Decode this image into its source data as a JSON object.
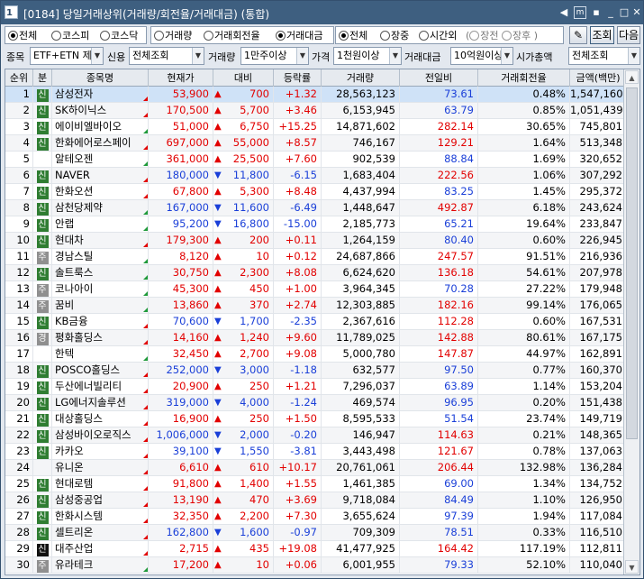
{
  "window": {
    "number": "1",
    "title": "[0184] 당일거래상위(거래량/회전율/거래대금) (통합)",
    "btn_left": "◀",
    "btn_box": "m",
    "btn_pin": "▪",
    "btn_min": "_",
    "btn_max": "□",
    "btn_close": "✕"
  },
  "market_filter": {
    "options": [
      "전체",
      "코스피",
      "코스닥"
    ],
    "selected": 0
  },
  "sort_filter": {
    "options": [
      "거래량",
      "거래회전율",
      "거래대금"
    ],
    "selected": 2
  },
  "session_filter": {
    "options": [
      "전체",
      "장중",
      "시간외"
    ],
    "selected": 0,
    "sub_options": [
      "장전",
      "장후"
    ]
  },
  "buttons": {
    "settings": "✎",
    "search": "조회",
    "next": "다음"
  },
  "filters": {
    "item_label": "종목",
    "item_value": "ETF+ETN 제",
    "credit_label": "신용",
    "credit_value": "전체조회",
    "volume_label": "거래량",
    "volume_value": "1만주이상",
    "price_label": "가격",
    "price_value": "1천원이상",
    "amount_label": "거래대금",
    "amount_value": "10억원이상",
    "mcap_label": "시가총액",
    "mcap_value": "전체조회"
  },
  "columns": [
    "순위",
    "분",
    "종목명",
    "현재가",
    "대비",
    "등락률",
    "거래량",
    "전일비",
    "거래회전율",
    "금액(백만)"
  ],
  "colors": {
    "badge_green": "#2f7d32",
    "badge_gray": "#8f8f8f",
    "badge_black": "#111111",
    "up": "#e20000",
    "down": "#1a3fd8"
  },
  "rows": [
    {
      "rank": "1",
      "tag": "신",
      "tag_color": "green",
      "name": "삼성전자",
      "price": "53,900",
      "arrow": "▲",
      "diff": "700",
      "rate": "+1.32",
      "volume": "28,563,123",
      "prev": "73.61",
      "turnover": "0.48%",
      "amount": "1,547,160",
      "dir": "up",
      "prev_dir": "dn",
      "mark": "red"
    },
    {
      "rank": "2",
      "tag": "신",
      "tag_color": "green",
      "name": "SK하이닉스",
      "price": "170,500",
      "arrow": "▲",
      "diff": "5,700",
      "rate": "+3.46",
      "volume": "6,153,945",
      "prev": "63.79",
      "turnover": "0.85%",
      "amount": "1,051,439",
      "dir": "up",
      "prev_dir": "dn",
      "mark": "red"
    },
    {
      "rank": "3",
      "tag": "신",
      "tag_color": "green",
      "name": "에이비엘바이오",
      "price": "51,000",
      "arrow": "▲",
      "diff": "6,750",
      "rate": "+15.25",
      "volume": "14,871,602",
      "prev": "282.14",
      "turnover": "30.65%",
      "amount": "745,801",
      "dir": "up",
      "prev_dir": "up",
      "mark": "green"
    },
    {
      "rank": "4",
      "tag": "신",
      "tag_color": "green",
      "name": "한화에어로스페이",
      "price": "697,000",
      "arrow": "▲",
      "diff": "55,000",
      "rate": "+8.57",
      "volume": "746,167",
      "prev": "129.21",
      "turnover": "1.64%",
      "amount": "513,348",
      "dir": "up",
      "prev_dir": "up",
      "mark": "red"
    },
    {
      "rank": "5",
      "tag": "",
      "tag_color": "",
      "name": "알테오젠",
      "price": "361,000",
      "arrow": "▲",
      "diff": "25,500",
      "rate": "+7.60",
      "volume": "902,539",
      "prev": "88.84",
      "turnover": "1.69%",
      "amount": "320,652",
      "dir": "up",
      "prev_dir": "dn",
      "mark": "green"
    },
    {
      "rank": "6",
      "tag": "신",
      "tag_color": "green",
      "name": "NAVER",
      "price": "180,000",
      "arrow": "▼",
      "diff": "11,800",
      "rate": "-6.15",
      "volume": "1,683,404",
      "prev": "222.56",
      "turnover": "1.06%",
      "amount": "307,292",
      "dir": "dn",
      "prev_dir": "up",
      "mark": "red"
    },
    {
      "rank": "7",
      "tag": "신",
      "tag_color": "green",
      "name": "한화오션",
      "price": "67,800",
      "arrow": "▲",
      "diff": "5,300",
      "rate": "+8.48",
      "volume": "4,437,994",
      "prev": "83.25",
      "turnover": "1.45%",
      "amount": "295,372",
      "dir": "up",
      "prev_dir": "dn",
      "mark": "red"
    },
    {
      "rank": "8",
      "tag": "신",
      "tag_color": "green",
      "name": "삼천당제약",
      "price": "167,000",
      "arrow": "▼",
      "diff": "11,600",
      "rate": "-6.49",
      "volume": "1,448,647",
      "prev": "492.87",
      "turnover": "6.18%",
      "amount": "243,624",
      "dir": "dn",
      "prev_dir": "up",
      "mark": "green"
    },
    {
      "rank": "9",
      "tag": "신",
      "tag_color": "green",
      "name": "안랩",
      "price": "95,200",
      "arrow": "▼",
      "diff": "16,800",
      "rate": "-15.00",
      "volume": "2,185,773",
      "prev": "65.21",
      "turnover": "19.64%",
      "amount": "233,847",
      "dir": "dn",
      "prev_dir": "dn",
      "mark": "green"
    },
    {
      "rank": "10",
      "tag": "신",
      "tag_color": "green",
      "name": "현대차",
      "price": "179,300",
      "arrow": "▲",
      "diff": "200",
      "rate": "+0.11",
      "volume": "1,264,159",
      "prev": "80.40",
      "turnover": "0.60%",
      "amount": "226,945",
      "dir": "up",
      "prev_dir": "dn",
      "mark": "red"
    },
    {
      "rank": "11",
      "tag": "주",
      "tag_color": "gray",
      "name": "경남스틸",
      "price": "8,120",
      "arrow": "▲",
      "diff": "10",
      "rate": "+0.12",
      "volume": "24,687,866",
      "prev": "247.57",
      "turnover": "91.51%",
      "amount": "216,936",
      "dir": "up",
      "prev_dir": "up",
      "mark": "green"
    },
    {
      "rank": "12",
      "tag": "신",
      "tag_color": "green",
      "name": "솔트룩스",
      "price": "30,750",
      "arrow": "▲",
      "diff": "2,300",
      "rate": "+8.08",
      "volume": "6,624,620",
      "prev": "136.18",
      "turnover": "54.61%",
      "amount": "207,978",
      "dir": "up",
      "prev_dir": "up",
      "mark": "green"
    },
    {
      "rank": "13",
      "tag": "주",
      "tag_color": "gray",
      "name": "코나아이",
      "price": "45,300",
      "arrow": "▲",
      "diff": "450",
      "rate": "+1.00",
      "volume": "3,964,345",
      "prev": "70.28",
      "turnover": "27.22%",
      "amount": "179,948",
      "dir": "up",
      "prev_dir": "dn",
      "mark": "green"
    },
    {
      "rank": "14",
      "tag": "주",
      "tag_color": "gray",
      "name": "꿈비",
      "price": "13,860",
      "arrow": "▲",
      "diff": "370",
      "rate": "+2.74",
      "volume": "12,303,885",
      "prev": "182.16",
      "turnover": "99.14%",
      "amount": "176,065",
      "dir": "up",
      "prev_dir": "up",
      "mark": "green"
    },
    {
      "rank": "15",
      "tag": "신",
      "tag_color": "green",
      "name": "KB금융",
      "price": "70,600",
      "arrow": "▼",
      "diff": "1,700",
      "rate": "-2.35",
      "volume": "2,367,616",
      "prev": "112.28",
      "turnover": "0.60%",
      "amount": "167,531",
      "dir": "dn",
      "prev_dir": "up",
      "mark": "red"
    },
    {
      "rank": "16",
      "tag": "경",
      "tag_color": "gray",
      "name": "평화홀딩스",
      "price": "14,160",
      "arrow": "▲",
      "diff": "1,240",
      "rate": "+9.60",
      "volume": "11,789,025",
      "prev": "142.88",
      "turnover": "80.61%",
      "amount": "167,175",
      "dir": "up",
      "prev_dir": "up",
      "mark": "red"
    },
    {
      "rank": "17",
      "tag": "",
      "tag_color": "",
      "name": "한텍",
      "price": "32,450",
      "arrow": "▲",
      "diff": "2,700",
      "rate": "+9.08",
      "volume": "5,000,780",
      "prev": "147.87",
      "turnover": "44.97%",
      "amount": "162,891",
      "dir": "up",
      "prev_dir": "up",
      "mark": "green"
    },
    {
      "rank": "18",
      "tag": "신",
      "tag_color": "green",
      "name": "POSCO홀딩스",
      "price": "252,000",
      "arrow": "▼",
      "diff": "3,000",
      "rate": "-1.18",
      "volume": "632,577",
      "prev": "97.50",
      "turnover": "0.77%",
      "amount": "160,370",
      "dir": "dn",
      "prev_dir": "dn",
      "mark": "red"
    },
    {
      "rank": "19",
      "tag": "신",
      "tag_color": "green",
      "name": "두산에너빌리티",
      "price": "20,900",
      "arrow": "▲",
      "diff": "250",
      "rate": "+1.21",
      "volume": "7,296,037",
      "prev": "63.89",
      "turnover": "1.14%",
      "amount": "153,204",
      "dir": "up",
      "prev_dir": "dn",
      "mark": "red"
    },
    {
      "rank": "20",
      "tag": "신",
      "tag_color": "green",
      "name": "LG에너지솔루션",
      "price": "319,000",
      "arrow": "▼",
      "diff": "4,000",
      "rate": "-1.24",
      "volume": "469,574",
      "prev": "96.95",
      "turnover": "0.20%",
      "amount": "151,438",
      "dir": "dn",
      "prev_dir": "dn",
      "mark": "red"
    },
    {
      "rank": "21",
      "tag": "신",
      "tag_color": "green",
      "name": "대상홀딩스",
      "price": "16,900",
      "arrow": "▲",
      "diff": "250",
      "rate": "+1.50",
      "volume": "8,595,533",
      "prev": "51.54",
      "turnover": "23.74%",
      "amount": "149,719",
      "dir": "up",
      "prev_dir": "dn",
      "mark": "red"
    },
    {
      "rank": "22",
      "tag": "신",
      "tag_color": "green",
      "name": "삼성바이오로직스",
      "price": "1,006,000",
      "arrow": "▼",
      "diff": "2,000",
      "rate": "-0.20",
      "volume": "146,947",
      "prev": "114.63",
      "turnover": "0.21%",
      "amount": "148,365",
      "dir": "dn",
      "prev_dir": "up",
      "mark": "red"
    },
    {
      "rank": "23",
      "tag": "신",
      "tag_color": "green",
      "name": "카카오",
      "price": "39,100",
      "arrow": "▼",
      "diff": "1,550",
      "rate": "-3.81",
      "volume": "3,443,498",
      "prev": "121.67",
      "turnover": "0.78%",
      "amount": "137,063",
      "dir": "dn",
      "prev_dir": "up",
      "mark": "red"
    },
    {
      "rank": "24",
      "tag": "",
      "tag_color": "",
      "name": "유니온",
      "price": "6,610",
      "arrow": "▲",
      "diff": "610",
      "rate": "+10.17",
      "volume": "20,761,061",
      "prev": "206.44",
      "turnover": "132.98%",
      "amount": "136,284",
      "dir": "up",
      "prev_dir": "up",
      "mark": "red"
    },
    {
      "rank": "25",
      "tag": "신",
      "tag_color": "green",
      "name": "현대로템",
      "price": "91,800",
      "arrow": "▲",
      "diff": "1,400",
      "rate": "+1.55",
      "volume": "1,461,385",
      "prev": "69.00",
      "turnover": "1.34%",
      "amount": "134,752",
      "dir": "up",
      "prev_dir": "dn",
      "mark": "red"
    },
    {
      "rank": "26",
      "tag": "신",
      "tag_color": "green",
      "name": "삼성중공업",
      "price": "13,190",
      "arrow": "▲",
      "diff": "470",
      "rate": "+3.69",
      "volume": "9,718,084",
      "prev": "84.49",
      "turnover": "1.10%",
      "amount": "126,950",
      "dir": "up",
      "prev_dir": "dn",
      "mark": "red"
    },
    {
      "rank": "27",
      "tag": "신",
      "tag_color": "green",
      "name": "한화시스템",
      "price": "32,350",
      "arrow": "▲",
      "diff": "2,200",
      "rate": "+7.30",
      "volume": "3,655,624",
      "prev": "97.39",
      "turnover": "1.94%",
      "amount": "117,084",
      "dir": "up",
      "prev_dir": "dn",
      "mark": "red"
    },
    {
      "rank": "28",
      "tag": "신",
      "tag_color": "green",
      "name": "셀트리온",
      "price": "162,800",
      "arrow": "▼",
      "diff": "1,600",
      "rate": "-0.97",
      "volume": "709,309",
      "prev": "78.51",
      "turnover": "0.33%",
      "amount": "116,510",
      "dir": "dn",
      "prev_dir": "dn",
      "mark": "red"
    },
    {
      "rank": "29",
      "tag": "신",
      "tag_color": "black",
      "name": "대주산업",
      "price": "2,715",
      "arrow": "▲",
      "diff": "435",
      "rate": "+19.08",
      "volume": "41,477,925",
      "prev": "164.42",
      "turnover": "117.19%",
      "amount": "112,811",
      "dir": "up",
      "prev_dir": "up",
      "mark": "red"
    },
    {
      "rank": "30",
      "tag": "주",
      "tag_color": "gray",
      "name": "유라테크",
      "price": "17,200",
      "arrow": "▲",
      "diff": "10",
      "rate": "+0.06",
      "volume": "6,001,955",
      "prev": "79.33",
      "turnover": "52.10%",
      "amount": "110,040",
      "dir": "up",
      "prev_dir": "dn",
      "mark": "green"
    }
  ]
}
